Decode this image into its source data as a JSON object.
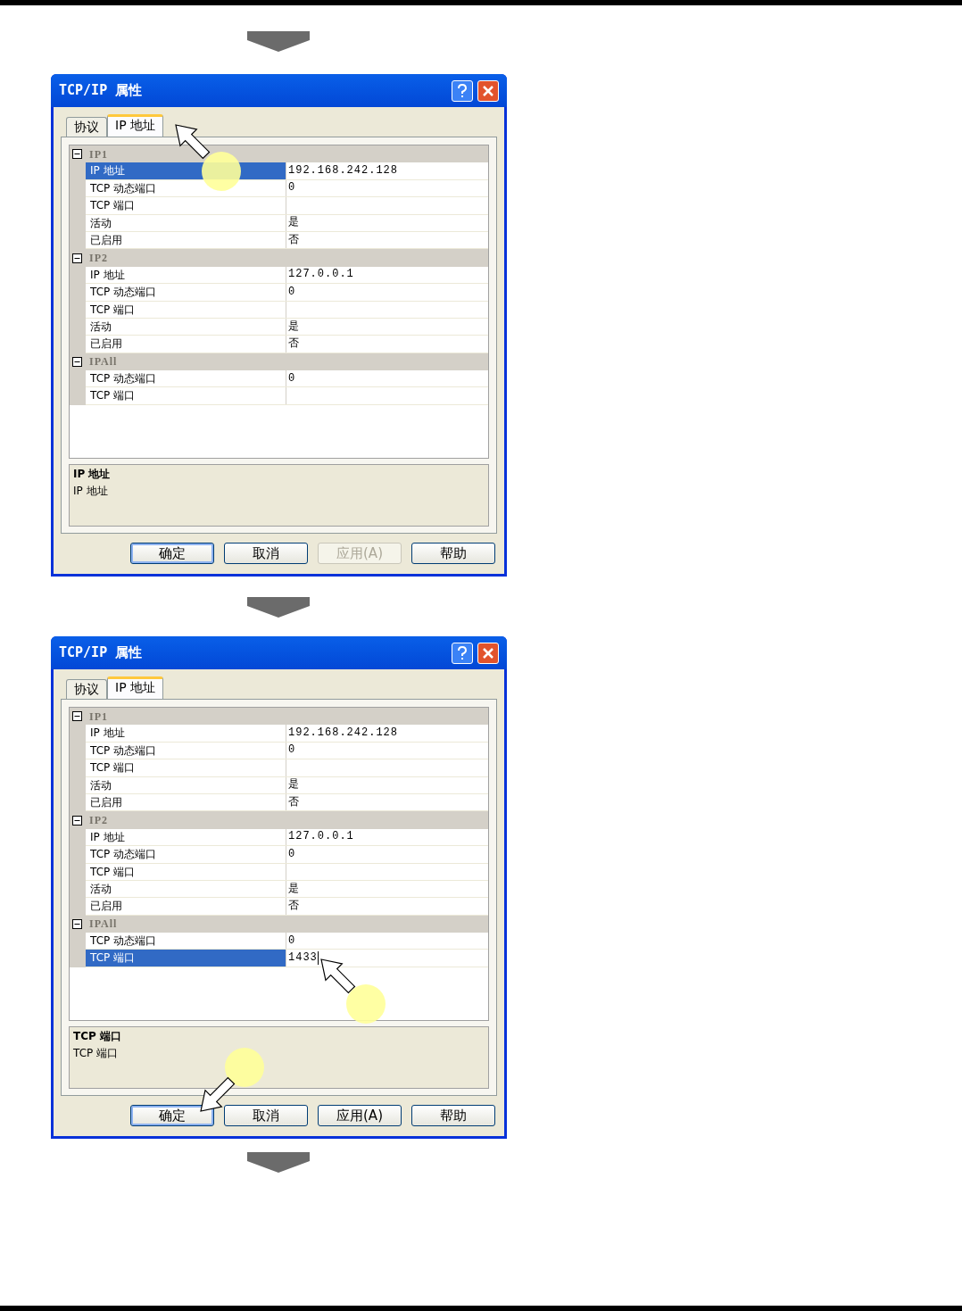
{
  "dialogs": [
    {
      "title": "TCP/IP 属性",
      "tabs": [
        {
          "label": "协议",
          "selected": false
        },
        {
          "label": "IP 地址",
          "selected": true
        }
      ],
      "groups": [
        {
          "name": "IP1",
          "expanded": true,
          "rows": [
            {
              "label": "IP 地址",
              "value": "192.168.242.128",
              "selected": true,
              "editing": false
            },
            {
              "label": "TCP 动态端口",
              "value": "0",
              "selected": false,
              "editing": false
            },
            {
              "label": "TCP 端口",
              "value": "",
              "selected": false,
              "editing": false
            },
            {
              "label": "活动",
              "value": "是",
              "selected": false,
              "editing": false
            },
            {
              "label": "已启用",
              "value": "否",
              "selected": false,
              "editing": false
            }
          ]
        },
        {
          "name": "IP2",
          "expanded": true,
          "rows": [
            {
              "label": "IP 地址",
              "value": "127.0.0.1",
              "selected": false,
              "editing": false
            },
            {
              "label": "TCP 动态端口",
              "value": "0",
              "selected": false,
              "editing": false
            },
            {
              "label": "TCP 端口",
              "value": "",
              "selected": false,
              "editing": false
            },
            {
              "label": "活动",
              "value": "是",
              "selected": false,
              "editing": false
            },
            {
              "label": "已启用",
              "value": "否",
              "selected": false,
              "editing": false
            }
          ]
        },
        {
          "name": "IPAll",
          "expanded": true,
          "rows": [
            {
              "label": "TCP 动态端口",
              "value": "0",
              "selected": false,
              "editing": false
            },
            {
              "label": "TCP 端口",
              "value": "",
              "selected": false,
              "editing": false
            }
          ]
        }
      ],
      "description": {
        "title": "IP 地址",
        "text": "IP 地址"
      },
      "buttons": [
        {
          "label": "确定",
          "disabled": false,
          "default": true
        },
        {
          "label": "取消",
          "disabled": false,
          "default": false
        },
        {
          "label": "应用(A)",
          "disabled": true,
          "default": false
        },
        {
          "label": "帮助",
          "disabled": false,
          "default": false
        }
      ]
    },
    {
      "title": "TCP/IP 属性",
      "tabs": [
        {
          "label": "协议",
          "selected": false
        },
        {
          "label": "IP 地址",
          "selected": true
        }
      ],
      "groups": [
        {
          "name": "IP1",
          "expanded": true,
          "rows": [
            {
              "label": "IP 地址",
              "value": "192.168.242.128",
              "selected": false,
              "editing": false
            },
            {
              "label": "TCP 动态端口",
              "value": "0",
              "selected": false,
              "editing": false
            },
            {
              "label": "TCP 端口",
              "value": "",
              "selected": false,
              "editing": false
            },
            {
              "label": "活动",
              "value": "是",
              "selected": false,
              "editing": false
            },
            {
              "label": "已启用",
              "value": "否",
              "selected": false,
              "editing": false
            }
          ]
        },
        {
          "name": "IP2",
          "expanded": true,
          "rows": [
            {
              "label": "IP 地址",
              "value": "127.0.0.1",
              "selected": false,
              "editing": false
            },
            {
              "label": "TCP 动态端口",
              "value": "0",
              "selected": false,
              "editing": false
            },
            {
              "label": "TCP 端口",
              "value": "",
              "selected": false,
              "editing": false
            },
            {
              "label": "活动",
              "value": "是",
              "selected": false,
              "editing": false
            },
            {
              "label": "已启用",
              "value": "否",
              "selected": false,
              "editing": false
            }
          ]
        },
        {
          "name": "IPAll",
          "expanded": true,
          "rows": [
            {
              "label": "TCP 动态端口",
              "value": "0",
              "selected": false,
              "editing": false
            },
            {
              "label": "TCP 端口",
              "value": "1433",
              "selected": true,
              "editing": true
            }
          ]
        }
      ],
      "description": {
        "title": "TCP 端口",
        "text": "TCP 端口"
      },
      "buttons": [
        {
          "label": "确定",
          "disabled": false,
          "default": true
        },
        {
          "label": "取消",
          "disabled": false,
          "default": false
        },
        {
          "label": "应用(A)",
          "disabled": false,
          "default": false
        },
        {
          "label": "帮助",
          "disabled": false,
          "default": false
        }
      ]
    }
  ]
}
